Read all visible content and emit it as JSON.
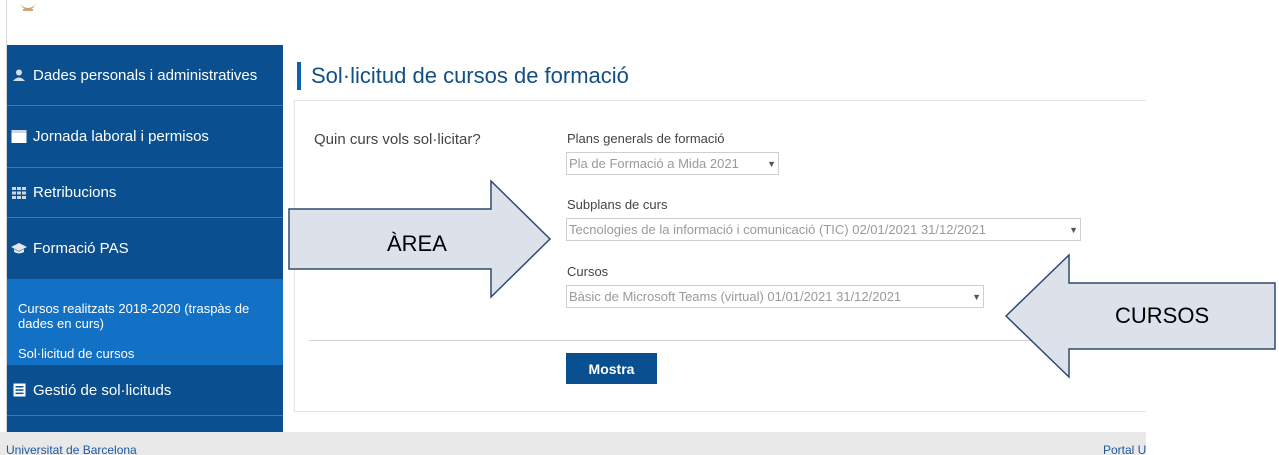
{
  "sidebar": {
    "items": [
      {
        "label": "Dades personals i administratives",
        "icon": "person-icon"
      },
      {
        "label": "Jornada laboral i permisos",
        "icon": "calendar-icon"
      },
      {
        "label": "Retribucions",
        "icon": "grid-icon"
      },
      {
        "label": "Formació PAS",
        "icon": "graduation-cap-icon"
      },
      {
        "label": "Gestió de sol·licituds",
        "icon": "list-icon"
      }
    ],
    "sub_items": [
      {
        "label": "Cursos realitzats 2018-2020 (traspàs de dades en curs)"
      },
      {
        "label": "Sol·licitud de cursos"
      }
    ]
  },
  "page": {
    "title": "Sol·licitud de cursos de formació",
    "question": "Quin curs vols sol·licitar?"
  },
  "form": {
    "plans_label": "Plans generals de formació",
    "plans_value": "Pla de Formació a Mida 2021",
    "subplans_label": "Subplans de curs",
    "subplans_value": "Tecnologies de la informació i comunicació (TIC) 02/01/2021 31/12/2021",
    "courses_label": "Cursos",
    "courses_value": "Bàsic de Microsoft Teams (virtual) 01/01/2021 31/12/2021",
    "submit_label": "Mostra"
  },
  "annotations": {
    "area_label": "ÀREA",
    "courses_label": "CURSOS"
  },
  "footer": {
    "left": "Universitat de Barcelona",
    "right": "Portal UB"
  },
  "colors": {
    "sidebar": "#0a4f8f",
    "sidebar_sub": "#1271c4",
    "accent": "#0d62ad",
    "arrow_fill": "#dde2ea"
  }
}
